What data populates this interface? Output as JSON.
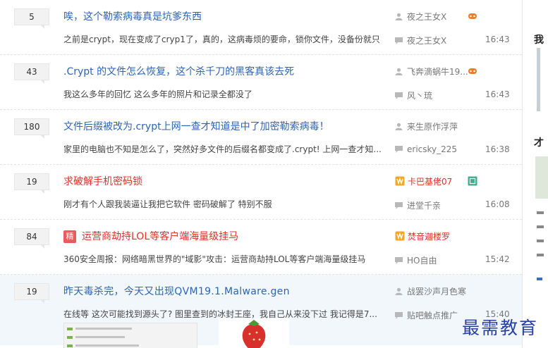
{
  "threads": [
    {
      "replies": "5",
      "title": "唉，这个勒索病毒真是坑爹东西",
      "abstract": "之前是crypt，现在变成了cryp1了，真的，这病毒烦的要命，锁你文件，没备份就只...",
      "author": "夜之王女X",
      "last_reply": "夜之王女X",
      "time": "16:43"
    },
    {
      "replies": "43",
      "title": ".Crypt 的文件怎么恢复，这个杀千刀的黑客真该去死",
      "abstract": "我这么多年的回忆 这么多年的照片和记录全都没了",
      "author": "飞奔滴蜗牛19...",
      "last_reply": "风丶琉",
      "time": "16:43"
    },
    {
      "replies": "180",
      "title": "文件后缀被改为.crypt上网一查才知道是中了加密勒索病毒！",
      "abstract": "家里的电脑也不知是怎么了，突然好多文件的后缀名都变成了.crypt! 上网一查才知...",
      "author": "来生原作浮萍",
      "last_reply": "ericsky_225",
      "time": "16:38"
    },
    {
      "replies": "19",
      "title": "求破解手机密码锁",
      "abstract": "刚才有个人跟我装逼让我把它软件 密码破解了 特别不服",
      "author": "卡巴基佬07",
      "last_reply": "进堂千亲",
      "time": "16:08"
    },
    {
      "replies": "84",
      "badge": "精",
      "title": "运营商劫持LOL等客户端海量级挂马",
      "abstract": "360安全周报：网络暗黑世界的\"域影\"攻击：运营商劫持LOL等客户端海量级挂马",
      "author": "焚音迦楼罗",
      "last_reply": "HO自由",
      "time": "15:42"
    },
    {
      "replies": "19",
      "title": "昨天毒杀完，今天又出现QVM19.1.Malware.gen",
      "abstract": "在线等 这次可能找到源头了? 图里查到的冰封王座，我自己从来没下过 我记得是7...",
      "author": "战罢沙声月色寒",
      "last_reply": "贴吧触点推广",
      "time": "15:40"
    }
  ],
  "sidebar": {
    "char1": "我",
    "char2": "才"
  },
  "watermark": "最需教育"
}
